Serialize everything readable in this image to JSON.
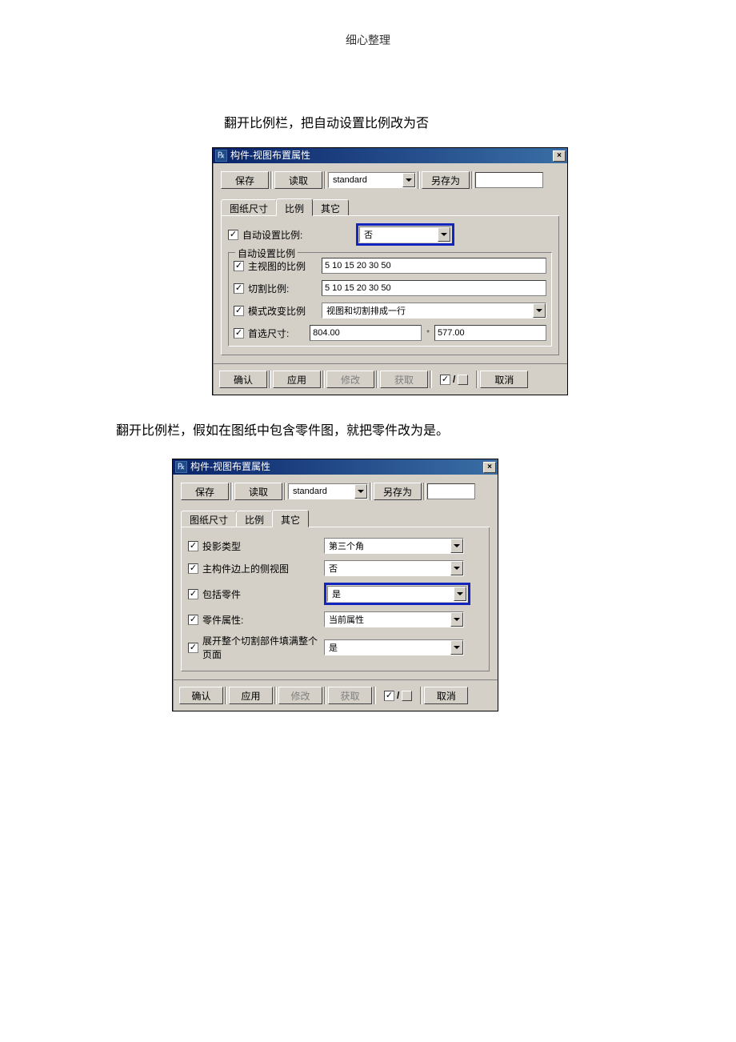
{
  "header": "细心整理",
  "instruction1": "翻开比例栏，把自动设置比例改为否",
  "instruction2": "翻开比例栏，假如在图纸中包含零件图，就把零件改为是。",
  "common": {
    "title": "构件-视图布置属性",
    "icon": "℞",
    "save": "保存",
    "load": "读取",
    "preset": "standard",
    "saveas": "另存为",
    "ok": "确认",
    "apply": "应用",
    "modify": "修改",
    "get": "获取",
    "cancel": "取消"
  },
  "tabs": {
    "t1": "图纸尺寸",
    "t2": "比例",
    "t3": "其它"
  },
  "d1": {
    "autoScale": {
      "label": "自动设置比例:",
      "value": "否"
    },
    "groupTitle": "自动设置比例",
    "mainView": {
      "label": "主视图的比例",
      "value": "5 10 15 20 30 50"
    },
    "cutScale": {
      "label": "切割比例:",
      "value": "5 10 15 20 30 50"
    },
    "modeChange": {
      "label": "模式改变比例",
      "value": "视图和切割排成一行"
    },
    "prefSize": {
      "label": "首选尺寸:",
      "w": "804.00",
      "h": "577.00"
    }
  },
  "d2": {
    "projType": {
      "label": "投影类型",
      "value": "第三个角"
    },
    "sideView": {
      "label": "主构件边上的侧视图",
      "value": "否"
    },
    "includeParts": {
      "label": "包括零件",
      "value": "是"
    },
    "partAttr": {
      "label": "零件属性:",
      "value": "当前属性"
    },
    "expandCut": {
      "label": "展开整个切割部件填满整个页面",
      "value": "是"
    }
  }
}
